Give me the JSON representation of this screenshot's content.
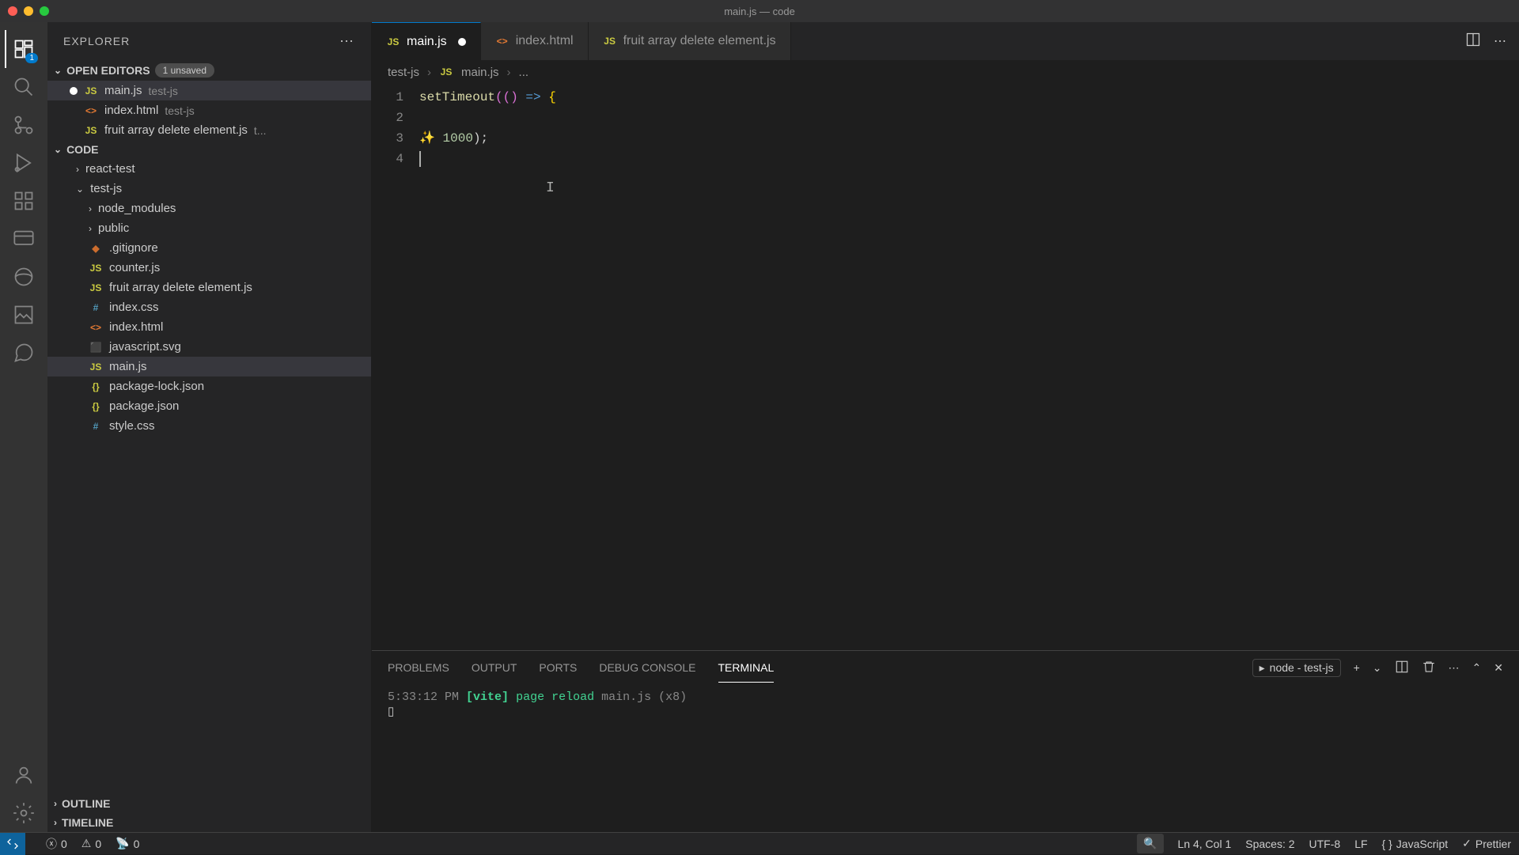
{
  "titlebar": {
    "title": "main.js — code"
  },
  "activityBar": {
    "badge": "1"
  },
  "sidebar": {
    "title": "EXPLORER",
    "openEditors": {
      "label": "OPEN EDITORS",
      "unsaved": "1 unsaved",
      "items": [
        {
          "icon": "JS",
          "iconClass": "fi-js",
          "name": "main.js",
          "suffix": "test-js",
          "modified": true
        },
        {
          "icon": "<>",
          "iconClass": "fi-html",
          "name": "index.html",
          "suffix": "test-js",
          "modified": false
        },
        {
          "icon": "JS",
          "iconClass": "fi-js",
          "name": "fruit array delete element.js",
          "suffix": "t...",
          "modified": false
        }
      ]
    },
    "code": {
      "label": "CODE",
      "folders": [
        {
          "name": "react-test",
          "expanded": false,
          "indent": 2
        },
        {
          "name": "test-js",
          "expanded": true,
          "indent": 2
        }
      ],
      "testJsChildren": [
        {
          "type": "folder",
          "name": "node_modules",
          "expanded": false
        },
        {
          "type": "folder",
          "name": "public",
          "expanded": false
        },
        {
          "type": "file",
          "icon": "◆",
          "iconClass": "fi-git",
          "name": ".gitignore"
        },
        {
          "type": "file",
          "icon": "JS",
          "iconClass": "fi-js",
          "name": "counter.js"
        },
        {
          "type": "file",
          "icon": "JS",
          "iconClass": "fi-js",
          "name": "fruit array delete element.js"
        },
        {
          "type": "file",
          "icon": "#",
          "iconClass": "fi-css",
          "name": "index.css"
        },
        {
          "type": "file",
          "icon": "<>",
          "iconClass": "fi-html",
          "name": "index.html"
        },
        {
          "type": "file",
          "icon": "⬛",
          "iconClass": "fi-svg",
          "name": "javascript.svg"
        },
        {
          "type": "file",
          "icon": "JS",
          "iconClass": "fi-js",
          "name": "main.js",
          "active": true
        },
        {
          "type": "file",
          "icon": "{}",
          "iconClass": "fi-json",
          "name": "package-lock.json"
        },
        {
          "type": "file",
          "icon": "{}",
          "iconClass": "fi-json",
          "name": "package.json"
        },
        {
          "type": "file",
          "icon": "#",
          "iconClass": "fi-css",
          "name": "style.css"
        }
      ]
    },
    "outline": "OUTLINE",
    "timeline": "TIMELINE"
  },
  "tabs": [
    {
      "icon": "JS",
      "iconClass": "fi-js",
      "name": "main.js",
      "active": true,
      "modified": true
    },
    {
      "icon": "<>",
      "iconClass": "fi-html",
      "name": "index.html",
      "active": false,
      "modified": false
    },
    {
      "icon": "JS",
      "iconClass": "fi-js",
      "name": "fruit array delete element.js",
      "active": false,
      "modified": false
    }
  ],
  "breadcrumb": {
    "folder": "test-js",
    "icon": "JS",
    "file": "main.js",
    "extra": "..."
  },
  "code": {
    "lines": [
      "1",
      "2",
      "3",
      "4"
    ],
    "l1_fn": "setTimeout",
    "l1_p1": "((",
    "l1_p2": ") ",
    "l1_arrow": "=>",
    "l1_brace": " {",
    "l3_sparkle": "✨",
    "l3_num": "1000",
    "l3_rest": ");"
  },
  "panel": {
    "tabs": {
      "problems": "PROBLEMS",
      "output": "OUTPUT",
      "ports": "PORTS",
      "debug": "DEBUG CONSOLE",
      "terminal": "TERMINAL"
    },
    "terminalSelect": "node - test-js",
    "terminal": {
      "time": "5:33:12 PM",
      "vite": "[vite]",
      "cmd": "page reload",
      "file": "main.js",
      "count": "(x8)"
    }
  },
  "status": {
    "errors": "0",
    "warnings": "0",
    "ports": "0",
    "lncol": "Ln 4, Col 1",
    "spaces": "Spaces: 2",
    "encoding": "UTF-8",
    "eol": "LF",
    "lang": "JavaScript",
    "prettier": "Prettier"
  }
}
